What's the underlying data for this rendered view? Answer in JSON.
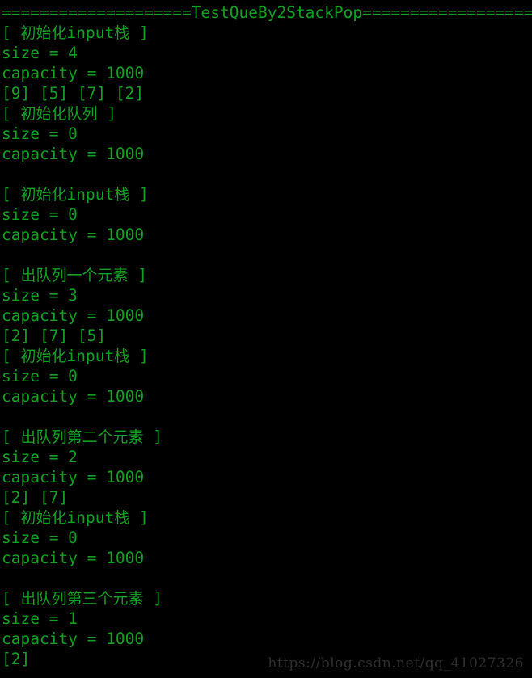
{
  "terminal": {
    "background_color": "#000000",
    "text_color": "#11a022",
    "watermark_color": "#2f2f2f",
    "watermark": "https://blog.csdn.net/qq_41027326",
    "lines": [
      "====================TestQueBy2StackPop====================",
      "[ 初始化input栈 ]",
      "size = 4",
      "capacity = 1000",
      "[9] [5] [7] [2]",
      "[ 初始化队列 ]",
      "size = 0",
      "capacity = 1000",
      "",
      "[ 初始化input栈 ]",
      "size = 0",
      "capacity = 1000",
      "",
      "[ 出队列一个元素 ]",
      "size = 3",
      "capacity = 1000",
      "[2] [7] [5]",
      "[ 初始化input栈 ]",
      "size = 0",
      "capacity = 1000",
      "",
      "[ 出队列第二个元素 ]",
      "size = 2",
      "capacity = 1000",
      "[2] [7]",
      "[ 初始化input栈 ]",
      "size = 0",
      "capacity = 1000",
      "",
      "[ 出队列第三个元素 ]",
      "size = 1",
      "capacity = 1000",
      "[2]"
    ]
  }
}
